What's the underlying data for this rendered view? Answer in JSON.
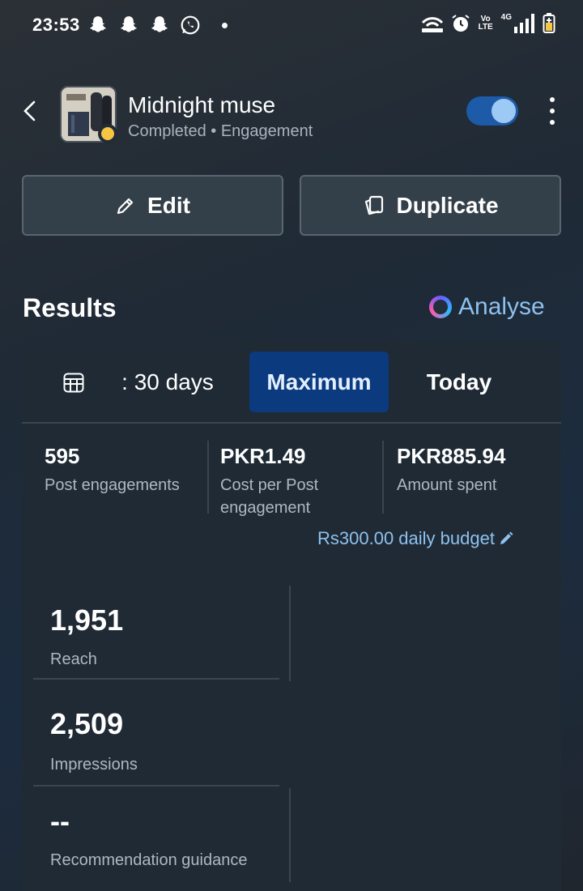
{
  "status_bar": {
    "time": "23:53",
    "left_icons": [
      "snapchat-icon",
      "snapchat-icon",
      "snapchat-icon",
      "whatsapp-icon"
    ],
    "right_icons": [
      "wifi-hotspot-icon",
      "alarm-icon",
      "volte-icon",
      "4g-signal-icon",
      "battery-icon"
    ],
    "volte_label": "Vo LTE",
    "network_label": "4G"
  },
  "header": {
    "campaign_name": "Midnight muse",
    "status_line": "Completed • Engagement",
    "status_color": "#f6c544",
    "toggle_on": true
  },
  "actions": {
    "edit_label": "Edit",
    "duplicate_label": "Duplicate"
  },
  "results": {
    "title": "Results",
    "analyse_label": "Analyse",
    "tabs": [
      {
        "label": ": 30 days",
        "selected": false
      },
      {
        "label": "Maximum",
        "selected": true
      },
      {
        "label": "Today",
        "selected": false
      }
    ],
    "metrics": [
      {
        "value": "595",
        "label": "Post engagements"
      },
      {
        "value": "PKR1.49",
        "label": "Cost per Post engagement"
      },
      {
        "value": "PKR885.94",
        "label": "Amount spent"
      }
    ],
    "budget_label": "Rs300.00 daily budget",
    "stats": [
      {
        "value": "1,951",
        "label": "Reach"
      },
      {
        "value": "2,509",
        "label": "Impressions"
      },
      {
        "value": "--",
        "label": "Recommendation guidance"
      }
    ]
  },
  "colors": {
    "accent_link": "#8ec1ef",
    "selected_tab": "#0b3a7e",
    "toggle_track": "#1d5aa8"
  }
}
